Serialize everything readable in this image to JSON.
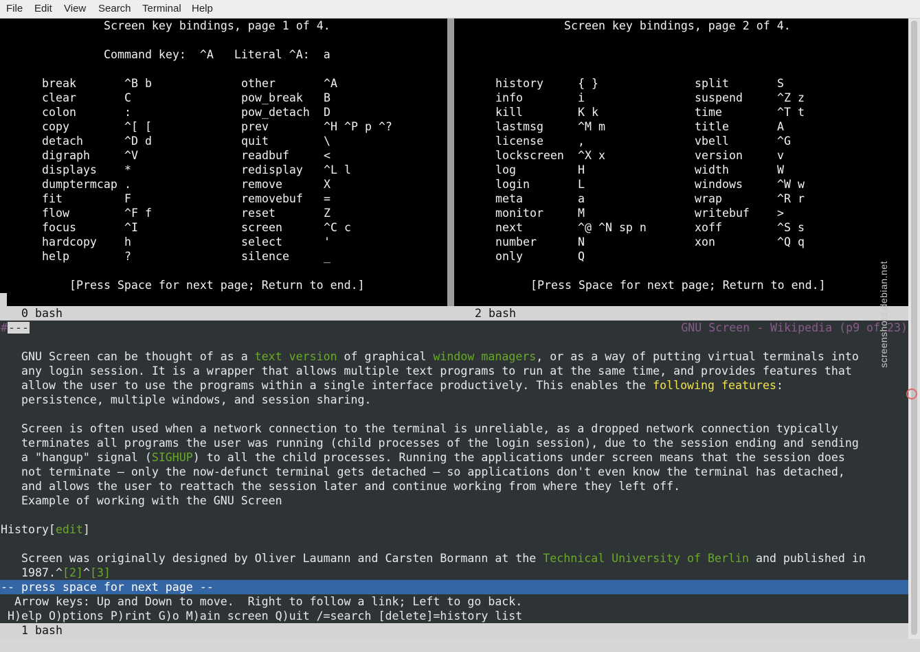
{
  "menubar": [
    "File",
    "Edit",
    "View",
    "Search",
    "Terminal",
    "Help"
  ],
  "pane_left": {
    "title": "Screen key bindings, page 1 of 4.",
    "command_key": "Command key:  ^A   Literal ^A:  a",
    "rows": [
      [
        "break",
        "^B b",
        "other",
        "^A"
      ],
      [
        "clear",
        "C",
        "pow_break",
        "B"
      ],
      [
        "colon",
        ":",
        "pow_detach",
        "D"
      ],
      [
        "copy",
        "^[ [",
        "prev",
        "^H ^P p ^?"
      ],
      [
        "detach",
        "^D d",
        "quit",
        "\\"
      ],
      [
        "digraph",
        "^V",
        "readbuf",
        "<"
      ],
      [
        "displays",
        "*",
        "redisplay",
        "^L l"
      ],
      [
        "dumptermcap",
        ".",
        "remove",
        "X"
      ],
      [
        "fit",
        "F",
        "removebuf",
        "="
      ],
      [
        "flow",
        "^F f",
        "reset",
        "Z"
      ],
      [
        "focus",
        "^I",
        "screen",
        "^C c"
      ],
      [
        "hardcopy",
        "h",
        "select",
        "'"
      ],
      [
        "help",
        "?",
        "silence",
        "_"
      ]
    ],
    "footer": "[Press Space for next page; Return to end.]",
    "status": "0 bash"
  },
  "pane_right": {
    "title": "Screen key bindings, page 2 of 4.",
    "rows": [
      [
        "history",
        "{ }",
        "split",
        "S"
      ],
      [
        "info",
        "i",
        "suspend",
        "^Z z"
      ],
      [
        "kill",
        "K k",
        "time",
        "^T t"
      ],
      [
        "lastmsg",
        "^M m",
        "title",
        "A"
      ],
      [
        "license",
        ",",
        "vbell",
        "^G"
      ],
      [
        "lockscreen",
        "^X x",
        "version",
        "v"
      ],
      [
        "log",
        "H",
        "width",
        "W"
      ],
      [
        "login",
        "L",
        "windows",
        "^W w"
      ],
      [
        "meta",
        "a",
        "wrap",
        "^R r"
      ],
      [
        "monitor",
        "M",
        "writebuf",
        ">"
      ],
      [
        "next",
        "^@ ^N sp n",
        "xoff",
        "^S s"
      ],
      [
        "number",
        "N",
        "xon",
        "^Q q"
      ],
      [
        "only",
        "Q",
        "",
        ""
      ]
    ],
    "footer": "[Press Space for next page; Return to end.]",
    "status": "2 bash"
  },
  "lynx": {
    "top_left": "#",
    "top_left_box": "---",
    "header_title": "GNU Screen - Wikipedia (p9 of 23)",
    "p1": {
      "l1a": "GNU Screen can be thought of as a ",
      "l1_link1": "text version",
      "l1b": " of graphical ",
      "l1_link2": "window managers",
      "l1c": ", or as a way of putting virtual terminals into",
      "l2": "any login session. It is a wrapper that allows multiple text programs to run at the same time, and provides features that",
      "l3a": "allow the user to use the programs within a single interface productively. This enables the ",
      "l3_link": "following features",
      "l3b": ":",
      "l4": "persistence, multiple windows, and session sharing."
    },
    "p2": {
      "l1": "Screen is often used when a network connection to the terminal is unreliable, as a dropped network connection typically",
      "l2": "terminates all programs the user was running (child processes of the login session), due to the session ending and sending",
      "l3a": "a \"hangup\" signal (",
      "l3_link": "SIGHUP",
      "l3b": ") to all the child processes. Running the applications under screen means that the session does",
      "l4": "not terminate – only the now-defunct terminal gets detached – so applications don't even know the terminal has detached,",
      "l5": "and allows the user to reattach the session later and continue working from where they left off.",
      "l6": "Example of working with the GNU Screen"
    },
    "history_a": "History[",
    "history_link": "edit",
    "history_b": "]",
    "p3": {
      "l1a": "Screen was originally designed by Oliver Laumann and Carsten Bormann at the ",
      "l1_link": "Technical University of Berlin",
      "l1b": " and published in",
      "l2a": "1987.^",
      "l2_link1": "[2]",
      "l2b": "^",
      "l2_link2": "[3]"
    },
    "press_space": "-- press space for next page --",
    "help1": "Arrow keys: Up and Down to move.  Right to follow a link; Left to go back.",
    "help2": "H)elp O)ptions P)rint G)o M)ain screen Q)uit /=search [delete]=history list",
    "status": "1 bash"
  },
  "watermark": "screenshots.debian.net"
}
